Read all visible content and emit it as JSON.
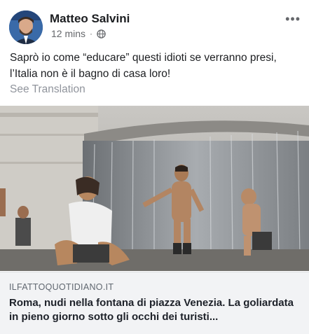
{
  "post": {
    "author": "Matteo Salvini",
    "time": "12 mins",
    "separator": "·",
    "privacy_icon": "globe-icon",
    "more_icon": "more-options-icon",
    "more_label": "•••",
    "text": "Saprò io come “educare” questi idioti se verranno presi, l’Italia non è il bagno di casa loro!",
    "translate_label": "See Translation"
  },
  "link_preview": {
    "domain": "ILFATTOQUOTIDIANO.IT",
    "headline": "Roma, nudi nella fontana di piazza Venezia. La goliardata in pieno giorno sotto gli occhi dei turisti..."
  },
  "colors": {
    "text": "#1c1e21",
    "secondary": "#65676b",
    "link_bg": "#f2f3f5"
  }
}
